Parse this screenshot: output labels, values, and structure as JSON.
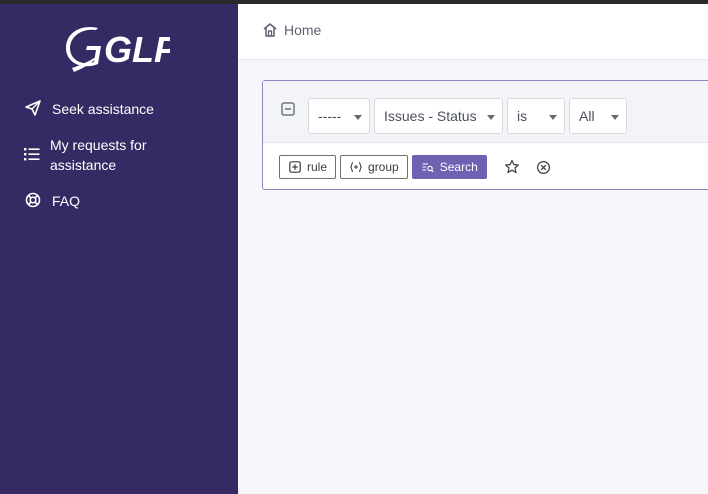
{
  "app": {
    "logo_text": "GLPI"
  },
  "sidebar": {
    "items": [
      {
        "label": "Seek assistance",
        "icon": "send-icon"
      },
      {
        "label": "My requests for assistance",
        "icon": "list-icon"
      },
      {
        "label": "FAQ",
        "icon": "lifebuoy-icon"
      }
    ]
  },
  "header": {
    "breadcrumb": "Home",
    "breadcrumb_icon": "home-icon"
  },
  "search": {
    "field_select": "-----",
    "item_select": "Issues - Status",
    "operator_select": "is",
    "value_select": "All",
    "buttons": {
      "rule": "rule",
      "group": "group",
      "search": "Search"
    }
  },
  "colors": {
    "sidebar_bg": "#352a63",
    "accent": "#7161b3",
    "card_border": "#8e86c2"
  }
}
